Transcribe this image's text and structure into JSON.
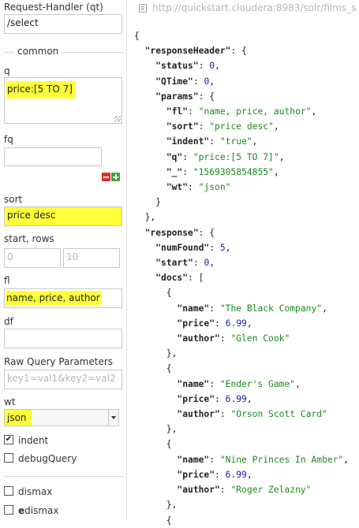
{
  "left": {
    "request_handler_label": "Request-Handler (qt)",
    "request_handler_value": "/select",
    "common_legend": "common",
    "q_label": "q",
    "q_value": "price:[5 TO 7]",
    "fq_label": "fq",
    "fq_value": "",
    "sort_label": "sort",
    "sort_value": "price desc",
    "start_rows_label": "start, rows",
    "start_placeholder": "0",
    "rows_placeholder": "10",
    "fl_label": "fl",
    "fl_value": "name, price, author",
    "df_label": "df",
    "df_value": "",
    "raw_label": "Raw Query Parameters",
    "raw_placeholder": "key1=val1&key2=val2",
    "wt_label": "wt",
    "wt_value": "json",
    "indent_label": "indent",
    "indent_checked": true,
    "debug_label": "debugQuery",
    "debug_checked": false,
    "dismax_label": "dismax",
    "edismax_label": "edismax",
    "highlight_color": "#ffff3b"
  },
  "url": "http://quickstart.cloudera:8983/solr/films_s",
  "response_lines": [
    [
      {
        "t": "p",
        "v": "{"
      }
    ],
    [
      {
        "t": "p",
        "v": "  "
      },
      {
        "t": "k",
        "v": "\"responseHeader\""
      },
      {
        "t": "p",
        "v": ": {"
      }
    ],
    [
      {
        "t": "p",
        "v": "    "
      },
      {
        "t": "k",
        "v": "\"status\""
      },
      {
        "t": "p",
        "v": ": "
      },
      {
        "t": "n",
        "v": "0"
      },
      {
        "t": "p",
        "v": ","
      }
    ],
    [
      {
        "t": "p",
        "v": "    "
      },
      {
        "t": "k",
        "v": "\"QTime\""
      },
      {
        "t": "p",
        "v": ": "
      },
      {
        "t": "n",
        "v": "0"
      },
      {
        "t": "p",
        "v": ","
      }
    ],
    [
      {
        "t": "p",
        "v": "    "
      },
      {
        "t": "k",
        "v": "\"params\""
      },
      {
        "t": "p",
        "v": ": {"
      }
    ],
    [
      {
        "t": "p",
        "v": "      "
      },
      {
        "t": "k",
        "v": "\"fl\""
      },
      {
        "t": "p",
        "v": ": "
      },
      {
        "t": "s",
        "v": "\"name, price, author\""
      },
      {
        "t": "p",
        "v": ","
      }
    ],
    [
      {
        "t": "p",
        "v": "      "
      },
      {
        "t": "k",
        "v": "\"sort\""
      },
      {
        "t": "p",
        "v": ": "
      },
      {
        "t": "s",
        "v": "\"price desc\""
      },
      {
        "t": "p",
        "v": ","
      }
    ],
    [
      {
        "t": "p",
        "v": "      "
      },
      {
        "t": "k",
        "v": "\"indent\""
      },
      {
        "t": "p",
        "v": ": "
      },
      {
        "t": "s",
        "v": "\"true\""
      },
      {
        "t": "p",
        "v": ","
      }
    ],
    [
      {
        "t": "p",
        "v": "      "
      },
      {
        "t": "k",
        "v": "\"q\""
      },
      {
        "t": "p",
        "v": ": "
      },
      {
        "t": "s",
        "v": "\"price:[5 TO 7]\""
      },
      {
        "t": "p",
        "v": ","
      }
    ],
    [
      {
        "t": "p",
        "v": "      "
      },
      {
        "t": "k",
        "v": "\"_\""
      },
      {
        "t": "p",
        "v": ": "
      },
      {
        "t": "s",
        "v": "\"1569305854855\""
      },
      {
        "t": "p",
        "v": ","
      }
    ],
    [
      {
        "t": "p",
        "v": "      "
      },
      {
        "t": "k",
        "v": "\"wt\""
      },
      {
        "t": "p",
        "v": ": "
      },
      {
        "t": "s",
        "v": "\"json\""
      }
    ],
    [
      {
        "t": "p",
        "v": "    }"
      }
    ],
    [
      {
        "t": "p",
        "v": "  },"
      }
    ],
    [
      {
        "t": "p",
        "v": "  "
      },
      {
        "t": "k",
        "v": "\"response\""
      },
      {
        "t": "p",
        "v": ": {"
      }
    ],
    [
      {
        "t": "p",
        "v": "    "
      },
      {
        "t": "k",
        "v": "\"numFound\""
      },
      {
        "t": "p",
        "v": ": "
      },
      {
        "t": "n",
        "v": "5"
      },
      {
        "t": "p",
        "v": ","
      }
    ],
    [
      {
        "t": "p",
        "v": "    "
      },
      {
        "t": "k",
        "v": "\"start\""
      },
      {
        "t": "p",
        "v": ": "
      },
      {
        "t": "n",
        "v": "0"
      },
      {
        "t": "p",
        "v": ","
      }
    ],
    [
      {
        "t": "p",
        "v": "    "
      },
      {
        "t": "k",
        "v": "\"docs\""
      },
      {
        "t": "p",
        "v": ": ["
      }
    ],
    [
      {
        "t": "p",
        "v": "      {"
      }
    ],
    [
      {
        "t": "p",
        "v": "        "
      },
      {
        "t": "k",
        "v": "\"name\""
      },
      {
        "t": "p",
        "v": ": "
      },
      {
        "t": "s",
        "v": "\"The Black Company\""
      },
      {
        "t": "p",
        "v": ","
      }
    ],
    [
      {
        "t": "p",
        "v": "        "
      },
      {
        "t": "k",
        "v": "\"price\""
      },
      {
        "t": "p",
        "v": ": "
      },
      {
        "t": "n",
        "v": "6.99"
      },
      {
        "t": "p",
        "v": ","
      }
    ],
    [
      {
        "t": "p",
        "v": "        "
      },
      {
        "t": "k",
        "v": "\"author\""
      },
      {
        "t": "p",
        "v": ": "
      },
      {
        "t": "s",
        "v": "\"Glen Cook\""
      }
    ],
    [
      {
        "t": "p",
        "v": "      },"
      }
    ],
    [
      {
        "t": "p",
        "v": "      {"
      }
    ],
    [
      {
        "t": "p",
        "v": "        "
      },
      {
        "t": "k",
        "v": "\"name\""
      },
      {
        "t": "p",
        "v": ": "
      },
      {
        "t": "s",
        "v": "\"Ender's Game\""
      },
      {
        "t": "p",
        "v": ","
      }
    ],
    [
      {
        "t": "p",
        "v": "        "
      },
      {
        "t": "k",
        "v": "\"price\""
      },
      {
        "t": "p",
        "v": ": "
      },
      {
        "t": "n",
        "v": "6.99"
      },
      {
        "t": "p",
        "v": ","
      }
    ],
    [
      {
        "t": "p",
        "v": "        "
      },
      {
        "t": "k",
        "v": "\"author\""
      },
      {
        "t": "p",
        "v": ": "
      },
      {
        "t": "s",
        "v": "\"Orson Scott Card\""
      }
    ],
    [
      {
        "t": "p",
        "v": "      },"
      }
    ],
    [
      {
        "t": "p",
        "v": "      {"
      }
    ],
    [
      {
        "t": "p",
        "v": "        "
      },
      {
        "t": "k",
        "v": "\"name\""
      },
      {
        "t": "p",
        "v": ": "
      },
      {
        "t": "s",
        "v": "\"Nine Princes In Amber\""
      },
      {
        "t": "p",
        "v": ","
      }
    ],
    [
      {
        "t": "p",
        "v": "        "
      },
      {
        "t": "k",
        "v": "\"price\""
      },
      {
        "t": "p",
        "v": ": "
      },
      {
        "t": "n",
        "v": "6.99"
      },
      {
        "t": "p",
        "v": ","
      }
    ],
    [
      {
        "t": "p",
        "v": "        "
      },
      {
        "t": "k",
        "v": "\"author\""
      },
      {
        "t": "p",
        "v": ": "
      },
      {
        "t": "s",
        "v": "\"Roger Zelazny\""
      }
    ],
    [
      {
        "t": "p",
        "v": "      },"
      }
    ],
    [
      {
        "t": "p",
        "v": "      {"
      }
    ]
  ]
}
